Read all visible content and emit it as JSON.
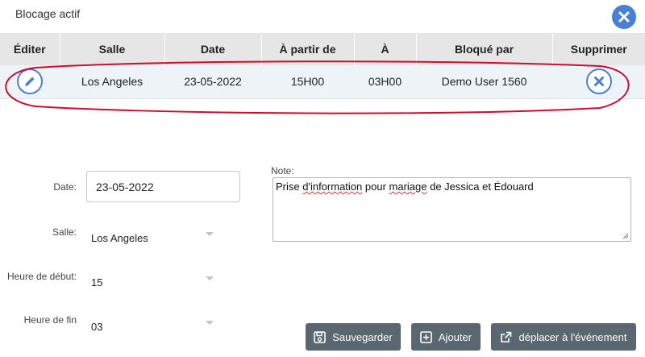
{
  "dialog": {
    "title": "Blocage actif"
  },
  "table": {
    "headers": [
      "Éditer",
      "Salle",
      "Date",
      "À partir de",
      "À",
      "Bloqué par",
      "Supprimer"
    ],
    "rows": [
      {
        "salle": "Los Angeles",
        "date": "23-05-2022",
        "from": "15H00",
        "to": "03H00",
        "blocked_by": "Demo User 1560"
      }
    ]
  },
  "form": {
    "date_label": "Date:",
    "date_value": "23-05-2022",
    "salle_label": "Salle:",
    "salle_value": "Los Angeles",
    "start_label": "Heure de début:",
    "start_value": "15",
    "end_label": "Heure de fin",
    "end_value": "03",
    "note_label": "Note:",
    "note_parts": [
      "Prise ",
      "d'information",
      " pour ",
      "mariage",
      " de Jessica et Édouard"
    ]
  },
  "buttons": {
    "save": "Sauvegarder",
    "add": "Ajouter",
    "move": "déplacer à l'événement"
  },
  "colors": {
    "accent": "#4a7fd8",
    "header_bg": "#e6e6e6",
    "row_bg": "#eef3f8",
    "button_bg": "#5b6770",
    "highlight": "#c8102e"
  },
  "icons": {
    "close": "close-circle-icon",
    "edit": "pencil-icon",
    "delete": "x-circle-icon",
    "save": "floppy-disk-icon",
    "add": "plus-square-icon",
    "move": "external-link-icon"
  }
}
